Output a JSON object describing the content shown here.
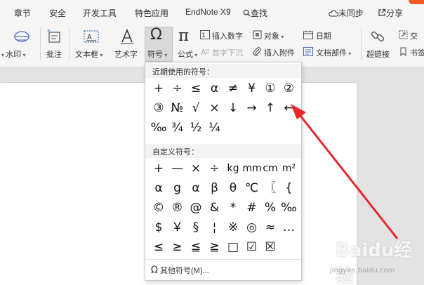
{
  "menu": {
    "tabs": [
      "章节",
      "安全",
      "开发工具",
      "特色应用",
      "EndNote X9",
      "查找"
    ],
    "sync": "未同步",
    "share": "分享"
  },
  "ribbon": {
    "watermark": "水印",
    "comment": "批注",
    "textbox": "文本框",
    "wordart": "艺术字",
    "symbol": "符号",
    "formula": "公式",
    "insert_number": "插入数字",
    "dropcap": "首字下沉",
    "object": "对象",
    "attachment": "插入附件",
    "date": "日期",
    "doc_parts": "文档部件",
    "hyperlink": "超链接",
    "cross_ref": "交",
    "bookmark": "书签"
  },
  "popup": {
    "recent_title": "近期使用的符号：",
    "recent_symbols": [
      "+",
      "÷",
      "≤",
      "α",
      "≠",
      "¥",
      "①",
      "②",
      "③",
      "№",
      "√",
      "×",
      "↓",
      "→",
      "↑",
      "←",
      "‰",
      "¾",
      "½",
      "¼"
    ],
    "custom_title": "自定义符号：",
    "custom_symbols": [
      "+",
      "—",
      "×",
      "÷",
      "kg",
      "mm",
      "cm",
      "m²",
      "α",
      "g",
      "α",
      "β",
      "θ",
      "℃",
      "〖",
      "{",
      "©",
      "®",
      "@",
      "&",
      "*",
      "#",
      "%",
      "‰",
      "$",
      "￥",
      "§",
      "¦",
      "※",
      "◎",
      "≈",
      "…",
      "≤",
      "≥",
      "≦",
      "≧",
      "□",
      "☑",
      "☒"
    ],
    "more_label": "其他符号(M)..."
  },
  "watermark_text": {
    "logo": "Baidu经验",
    "url": "jingyan.baidu.com"
  },
  "colors": {
    "accent": "#f15a22",
    "arrow": "#e8262b"
  }
}
